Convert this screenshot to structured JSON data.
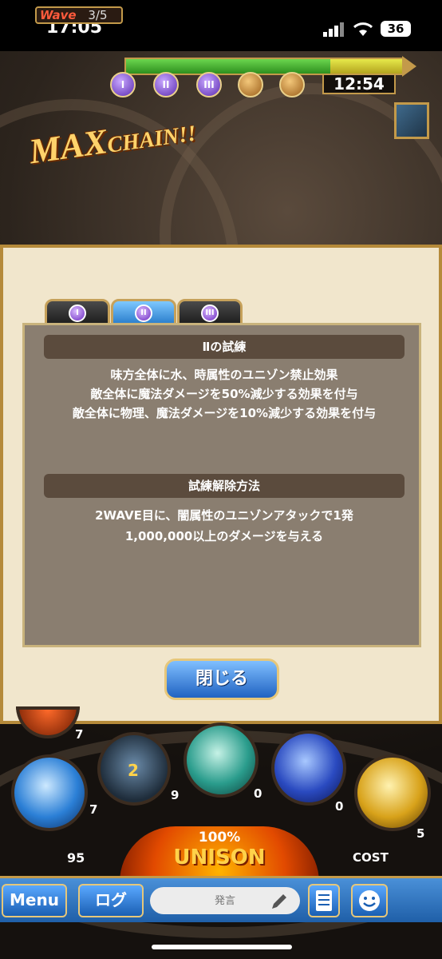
{
  "status_bar": {
    "time": "17:05",
    "battery": "36"
  },
  "hud": {
    "wave_word": "Wave",
    "wave_count": "3/5",
    "timer": "12:54",
    "stages": [
      "I",
      "II",
      "III"
    ],
    "banner_max": "MAX",
    "banner_chain": "CHAIN!!"
  },
  "modal": {
    "tabs": [
      {
        "label": "I",
        "active": false
      },
      {
        "label": "II",
        "active": true
      },
      {
        "label": "III",
        "active": false
      }
    ],
    "trial_title": "Ⅱの試練",
    "trial_lines": [
      "味方全体に水、時属性のユニゾン禁止効果",
      "敵全体に魔法ダメージを50%減少する効果を付与",
      "敵全体に物理、魔法ダメージを10%減少する効果を付与"
    ],
    "release_title": "試練解除方法",
    "release_lines": [
      "2WAVE目に、闇属性のユニゾンアタックで1発",
      "1,000,000以上のダメージを与える"
    ],
    "close_label": "閉じる"
  },
  "skills": {
    "counts": [
      "7",
      "7",
      "2",
      "9",
      "0",
      "0",
      "5"
    ]
  },
  "unison": {
    "percent": "100%",
    "label": "UNISON",
    "left_num": "95",
    "right_label": "COST"
  },
  "bottom": {
    "menu_label": "Menu",
    "log_label": "ログ",
    "chat_placeholder": "発言"
  }
}
